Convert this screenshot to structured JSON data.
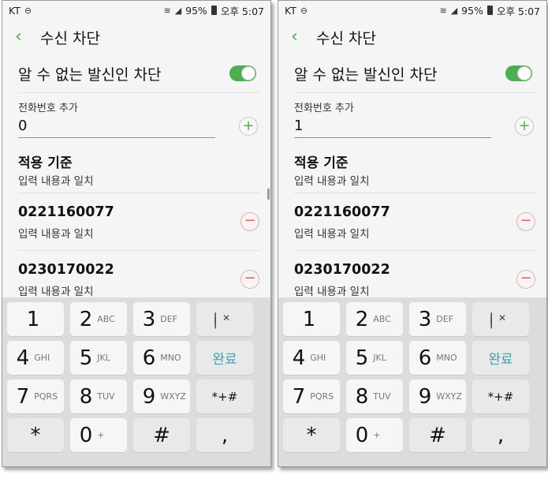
{
  "status": {
    "carrier": "KT",
    "battery": "95%",
    "time": "오후 5:07"
  },
  "appbar": {
    "title": "수신 차단"
  },
  "toggle": {
    "label": "알 수 없는 발신인 차단",
    "on": true
  },
  "add": {
    "label": "전화번호 추가"
  },
  "criteria": {
    "title": "적용 기준",
    "value": "입력 내용과 일치"
  },
  "entries": [
    {
      "number": "0221160077",
      "sub": "입력 내용과 일치"
    },
    {
      "number": "0230170022",
      "sub": "입력 내용과 일치"
    }
  ],
  "screens": [
    {
      "input_value": "0"
    },
    {
      "input_value": "1"
    }
  ],
  "keypad": {
    "keys": [
      {
        "digit": "1",
        "letters": ""
      },
      {
        "digit": "2",
        "letters": "ABC"
      },
      {
        "digit": "3",
        "letters": "DEF"
      },
      {
        "digit": "4",
        "letters": "GHI"
      },
      {
        "digit": "5",
        "letters": "JKL"
      },
      {
        "digit": "6",
        "letters": "MNO"
      },
      {
        "digit": "7",
        "letters": "PQRS"
      },
      {
        "digit": "8",
        "letters": "TUV"
      },
      {
        "digit": "9",
        "letters": "WXYZ"
      },
      {
        "digit": "*",
        "letters": ""
      },
      {
        "digit": "0",
        "letters": "+"
      },
      {
        "digit": "#",
        "letters": ""
      }
    ],
    "done": "완료",
    "symbols": "*+#",
    "comma": ","
  },
  "colors": {
    "accent": "#4caf50",
    "remove": "#e25a5a",
    "done": "#3aa2b1"
  }
}
